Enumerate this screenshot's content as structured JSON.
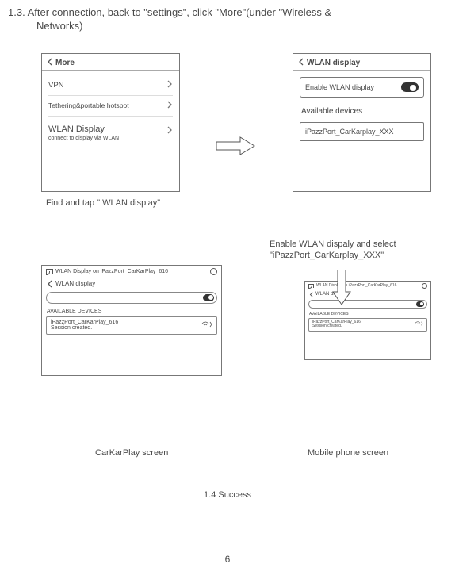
{
  "heading_line1": "1.3. After connection, back to \"settings\",  click \"More\"(under \"Wireless &",
  "heading_line2": "Networks)",
  "panel1": {
    "title": "More",
    "items": [
      {
        "label": "VPN"
      },
      {
        "label": "Tethering&portable hotspot"
      },
      {
        "label": "WLAN Display",
        "sub": "connect to display via WLAN"
      }
    ]
  },
  "panel2": {
    "title": "WLAN display",
    "enable_label": "Enable WLAN display",
    "available_label": "Available devices",
    "device": "iPazzPort_CarKarplay_XXX"
  },
  "caption_left": "Find and tap \" WLAN display\"",
  "caption_right_l1": "Enable WLAN dispaly and select",
  "caption_right_l2": "\"iPazzPort_CarKarplay_XXX\"",
  "detail_panel": {
    "cast_text": "WLAN Display on iPazzPort_CarKarPlay_616",
    "wlan_label": "WLAN display",
    "available": "AVAILABLE DEVICES",
    "device_name": "iPazzPort_CarKarPlay_616",
    "device_status": "Session created."
  },
  "caption3": "CarKarPlay screen",
  "caption4": "Mobile phone screen",
  "success": "1.4 Success",
  "pagenum": "6"
}
